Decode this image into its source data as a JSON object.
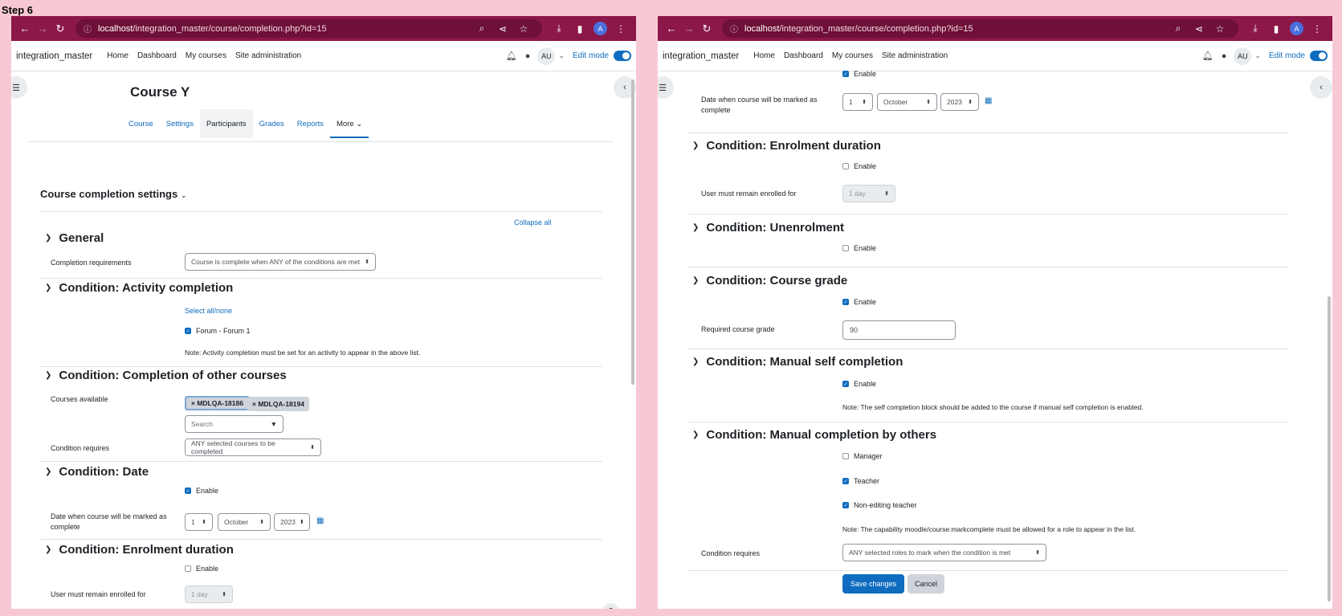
{
  "step_label": "Step 6",
  "browser": {
    "url_host": "localhost",
    "url_path": "/integration_master/course/completion.php?id=15",
    "profile_initial": "A"
  },
  "topnav": {
    "site_name": "integration_master",
    "links": [
      "Home",
      "Dashboard",
      "My courses",
      "Site administration"
    ],
    "user_initials": "AU",
    "edit_mode_label": "Edit mode"
  },
  "course": {
    "title": "Course Y",
    "tabs": [
      "Course",
      "Settings",
      "Participants",
      "Grades",
      "Reports",
      "More"
    ]
  },
  "page": {
    "heading": "Course completion settings",
    "collapse_all": "Collapse all"
  },
  "general": {
    "title": "General",
    "requirements_label": "Completion requirements",
    "requirements_value": "Course is complete when ANY of the conditions are met"
  },
  "activity": {
    "title": "Condition: Activity completion",
    "select_all": "Select all/none",
    "item": "Forum - Forum 1",
    "note": "Note: Activity completion must be set for an activity to appear in the above list."
  },
  "other_courses": {
    "title": "Condition: Completion of other courses",
    "available_label": "Courses available",
    "chips": [
      "× MDLQA-18186",
      "× MDLQA-18194"
    ],
    "search_placeholder": "Search",
    "requires_label": "Condition requires",
    "requires_value": "ANY selected courses to be completed"
  },
  "date": {
    "title": "Condition: Date",
    "enable_label": "Enable",
    "date_label_1": "Date when course will be marked as",
    "date_label_2": "complete",
    "day": "1",
    "month": "October",
    "year": "2023"
  },
  "enrolment_duration": {
    "title": "Condition: Enrolment duration",
    "enable_label": "Enable",
    "remain_label": "User must remain enrolled for",
    "remain_value": "1 day"
  },
  "unenrolment": {
    "title": "Condition: Unenrolment",
    "enable_label": "Enable"
  },
  "course_grade": {
    "title": "Condition: Course grade",
    "enable_label": "Enable",
    "required_label": "Required course grade",
    "required_value": "90"
  },
  "manual_self": {
    "title": "Condition: Manual self completion",
    "enable_label": "Enable",
    "note": "Note: The self completion block should be added to the course if manual self completion is enabled."
  },
  "manual_others": {
    "title": "Condition: Manual completion by others",
    "roles": [
      "Manager",
      "Teacher",
      "Non-editing teacher"
    ],
    "note": "Note: The capability moodle/course:markcomplete must be allowed for a role to appear in the list.",
    "requires_label": "Condition requires",
    "requires_value": "ANY selected roles to mark when the condition is met"
  },
  "actions": {
    "save": "Save changes",
    "cancel": "Cancel"
  },
  "help_label": "?",
  "icons": {
    "up_down": "⬍",
    "chevron_down": "⌄",
    "calendar": "▦"
  },
  "colors": {
    "browser_bar": "#8b1849",
    "link": "#0f6cbf",
    "background": "#f8c9d4"
  }
}
